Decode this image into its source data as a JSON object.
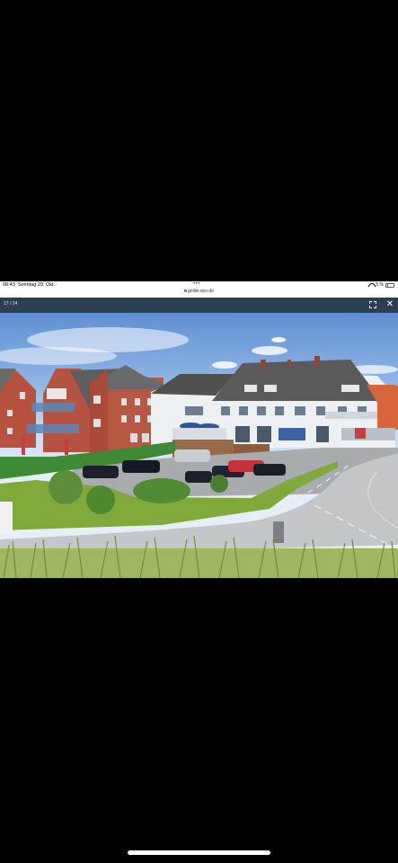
{
  "status_bar": {
    "time": "08:43",
    "date": "Sonntag 29. Okt.",
    "dots": "•••",
    "battery": "5 %"
  },
  "url_bar": {
    "url": "golde-spo.de"
  },
  "viewer": {
    "counter": "17 / 24",
    "fullscreen_icon": "fullscreen-icon",
    "close_icon": "close-icon",
    "close_glyph": "✕"
  },
  "photo": {
    "subject": "coastal-street-with-brick-and-white-houses"
  },
  "colors": {
    "viewer_bar": "#2c3e50",
    "status_bg": "#ffffff",
    "page_bg": "#000000"
  }
}
